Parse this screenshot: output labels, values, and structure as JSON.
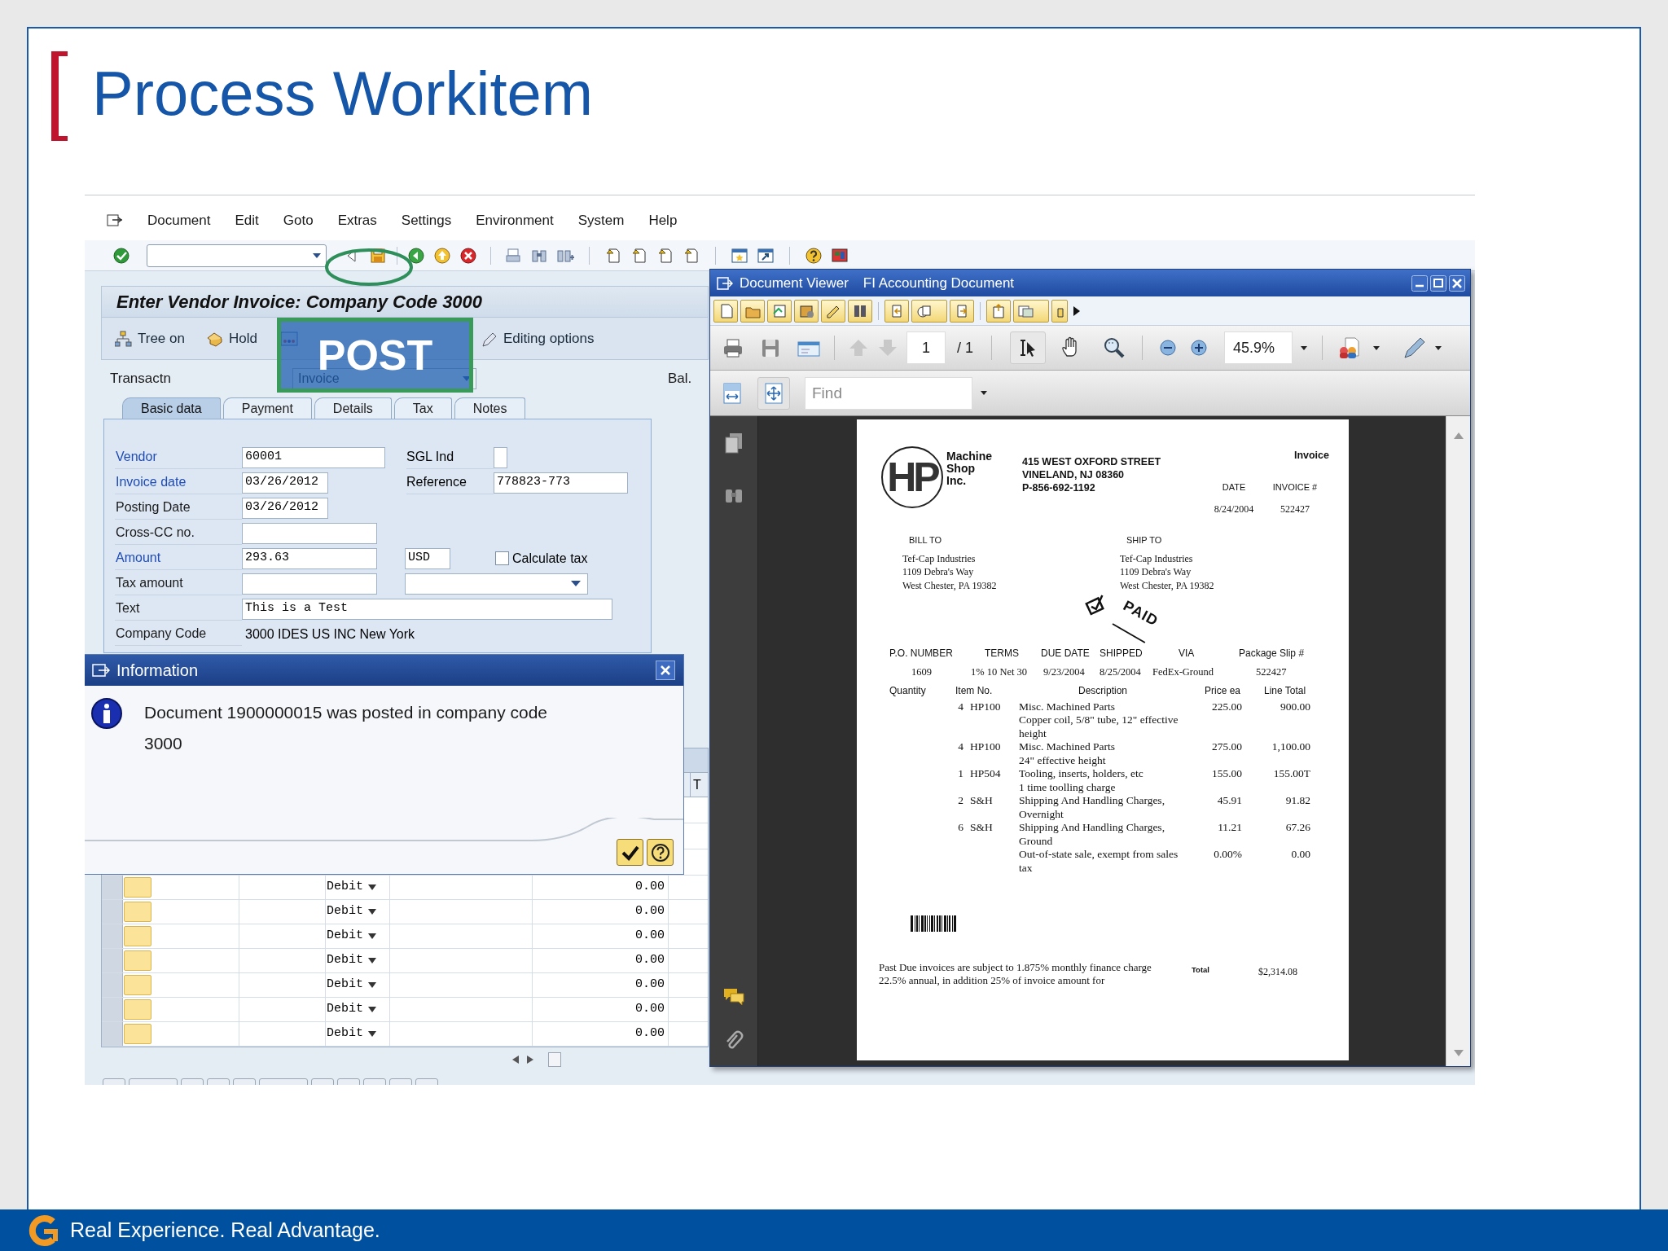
{
  "slide": {
    "title": "Process Workitem",
    "footer": "Real Experience. Real Advantage."
  },
  "sap": {
    "menu": [
      "Document",
      "Edit",
      "Goto",
      "Extras",
      "Settings",
      "Environment",
      "System",
      "Help"
    ],
    "screen_title": "Enter Vendor Invoice: Company Code 3000",
    "app_toolbar": [
      {
        "kind": "tree",
        "label": "Tree on"
      },
      {
        "kind": "hold",
        "label": "Hold"
      },
      {
        "kind": "simulate"
      },
      {
        "kind": "edit",
        "label": "Editing options"
      }
    ],
    "overlay_label": "POST",
    "transaction": {
      "label": "Transactn",
      "value": "Invoice"
    },
    "balance_label": "Bal.",
    "tabs": [
      {
        "label": "Basic data",
        "selected": true
      },
      {
        "label": "Payment",
        "selected": false
      },
      {
        "label": "Details",
        "selected": false
      },
      {
        "label": "Tax",
        "selected": false
      },
      {
        "label": "Notes",
        "selected": false
      }
    ],
    "form": [
      {
        "label": "Vendor",
        "required": true,
        "kind": "field",
        "value": "60001",
        "extras": [
          {
            "kind": "label_checkbox",
            "label": "SGL Ind",
            "checked": false
          }
        ]
      },
      {
        "label": "Invoice date",
        "required": true,
        "kind": "field",
        "value": "03/26/2012",
        "extras": [
          {
            "kind": "label_field",
            "label": "Reference",
            "value": "778823-773"
          }
        ]
      },
      {
        "label": "Posting Date",
        "required": false,
        "kind": "field",
        "value": "03/26/2012"
      },
      {
        "label": "Cross-CC no.",
        "required": false,
        "kind": "field"
      },
      {
        "label": "Amount",
        "required": true,
        "kind": "field",
        "value": "293.63",
        "extras": [
          {
            "kind": "field",
            "value": "USD"
          },
          {
            "kind": "checkbox",
            "label": "Calculate tax",
            "checked": false
          }
        ]
      },
      {
        "label": "Tax amount",
        "required": false,
        "kind": "field",
        "extras": [
          {
            "kind": "dropdown"
          }
        ]
      },
      {
        "label": "Text",
        "required": false,
        "kind": "field",
        "value": "This is a Test"
      },
      {
        "label": "Company Code",
        "required": false,
        "kind": "display",
        "value": "3000 IDES US INC New York"
      }
    ],
    "dialog": {
      "title": "Information",
      "message": "Document 1900000015 was posted in company code 3000"
    },
    "column_header_partial": "T",
    "rows": [
      {
        "type": "Debit",
        "amount": "0.00"
      },
      {
        "type": "Debit",
        "amount": "0.00"
      },
      {
        "type": "Debit",
        "amount": "0.00"
      },
      {
        "type": "Debit",
        "amount": "0.00"
      },
      {
        "type": "Debit",
        "amount": "0.00"
      },
      {
        "type": "Debit",
        "amount": "0.00"
      },
      {
        "type": "Debit",
        "amount": "0.00"
      }
    ]
  },
  "viewer": {
    "title": "Document Viewer",
    "subtitle": "FI Accounting Document",
    "page": "1",
    "page_count": "/ 1",
    "zoom": "45.9%",
    "find_placeholder": "Find",
    "invoice": {
      "logo": "HP",
      "company": [
        "Machine",
        "Shop",
        "Inc."
      ],
      "address": [
        "415 WEST OXFORD STREET",
        "VINELAND, NJ 08360",
        "P-856-692-1192"
      ],
      "doc_type": "Invoice",
      "meta": [
        {
          "label": "DATE",
          "value": "8/24/2004"
        },
        {
          "label": "INVOICE #",
          "value": "522427"
        }
      ],
      "bill_to": {
        "label": "BILL TO",
        "lines": [
          "Tef-Cap Industries",
          "1109 Debra's Way",
          "West Chester, PA 19382"
        ]
      },
      "ship_to": {
        "label": "SHIP TO",
        "lines": [
          "Tef-Cap Industries",
          "1109 Debra's Way",
          "West Chester, PA 19382"
        ]
      },
      "stamp": "PAID",
      "order_columns": [
        "P.O. NUMBER",
        "TERMS",
        "DUE DATE",
        "SHIPPED",
        "VIA",
        "Package Slip #"
      ],
      "order_values": [
        "1609",
        "1% 10 Net 30",
        "9/23/2004",
        "8/25/2004",
        "FedEx-Ground",
        "522427"
      ],
      "item_columns": [
        "Quantity",
        "Item No.",
        "Description",
        "Price ea",
        "Line Total"
      ],
      "items": [
        {
          "quantity": "4",
          "item": "HP100",
          "description": [
            "Misc. Machined Parts",
            "Copper coil, 5/8\" tube, 12\" effective height"
          ],
          "price": "225.00",
          "total": "900.00"
        },
        {
          "quantity": "4",
          "item": "HP100",
          "description": [
            "Misc. Machined Parts",
            "24\" effective height"
          ],
          "price": "275.00",
          "total": "1,100.00"
        },
        {
          "quantity": "1",
          "item": "HP504",
          "description": [
            "Tooling, inserts, holders, etc",
            "1 time toolling charge"
          ],
          "price": "155.00",
          "total": "155.00T"
        },
        {
          "quantity": "2",
          "item": "S&H",
          "description": [
            "Shipping And Handling Charges, Overnight"
          ],
          "price": "45.91",
          "total": "91.82"
        },
        {
          "quantity": "6",
          "item": "S&H",
          "description": [
            "Shipping And Handling Charges, Ground"
          ],
          "price": "11.21",
          "total": "67.26"
        },
        {
          "description": [
            "Out-of-state sale, exempt from sales tax"
          ],
          "price": "0.00%",
          "total": "0.00"
        }
      ],
      "note": "Past Due invoices are subject  to 1.875% monthly finance charge 22.5% annual, in addition 25% of invoice amount for",
      "total_label": "Total",
      "total": "$2,314.08"
    }
  }
}
